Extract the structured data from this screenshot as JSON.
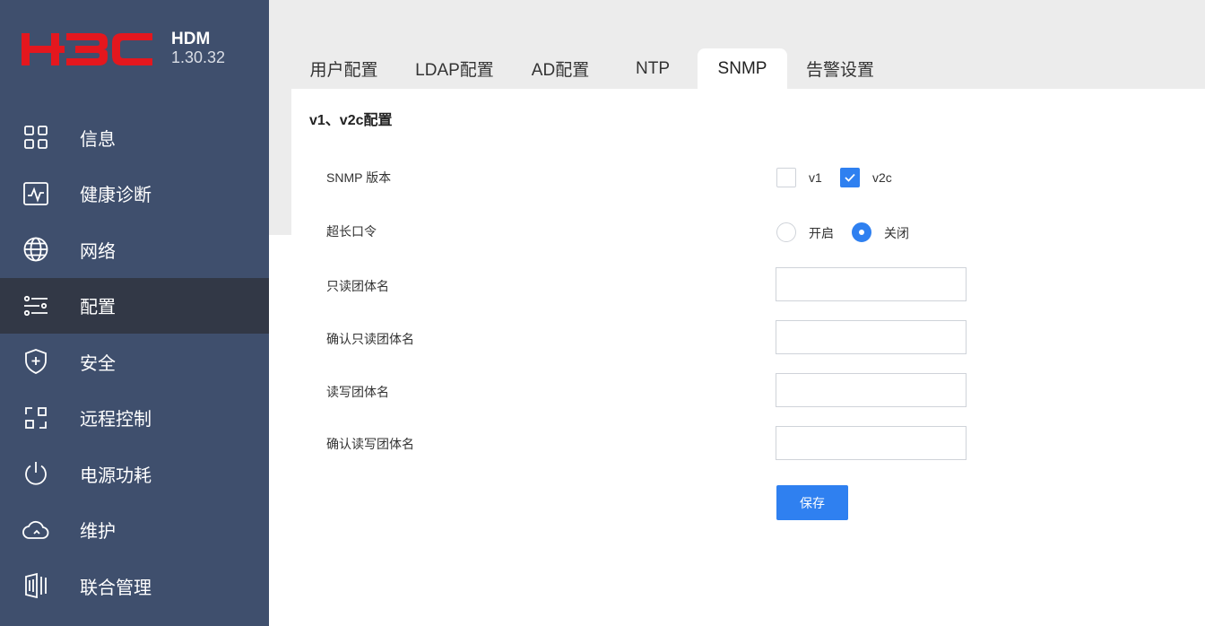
{
  "app": {
    "name": "HDM",
    "version": "1.30.32",
    "brand_color": "#e4171e",
    "logo_text": "H3C"
  },
  "sidebar": {
    "items": [
      {
        "label": "信息",
        "icon": "grid-icon"
      },
      {
        "label": "健康诊断",
        "icon": "health-monitor-icon"
      },
      {
        "label": "网络",
        "icon": "globe-icon"
      },
      {
        "label": "配置",
        "icon": "sliders-icon",
        "active": true
      },
      {
        "label": "安全",
        "icon": "shield-plus-icon"
      },
      {
        "label": "远程控制",
        "icon": "remote-control-icon"
      },
      {
        "label": "电源功耗",
        "icon": "power-icon"
      },
      {
        "label": "维护",
        "icon": "cloud-icon"
      },
      {
        "label": "联合管理",
        "icon": "server-rack-icon"
      }
    ]
  },
  "tabs": [
    {
      "label": "用户配置"
    },
    {
      "label": "LDAP配置"
    },
    {
      "label": "AD配置"
    },
    {
      "label": "NTP"
    },
    {
      "label": "SNMP",
      "active": true
    },
    {
      "label": "告警设置"
    }
  ],
  "section": {
    "title": "v1、v2c配置"
  },
  "form": {
    "snmp_version_label": "SNMP 版本",
    "v1_label": "v1",
    "v1_checked": false,
    "v2c_label": "v2c",
    "v2c_checked": true,
    "long_password_label": "超长口令",
    "on_label": "开启",
    "off_label": "关闭",
    "long_password_value": "关闭",
    "ro_community_label": "只读团体名",
    "ro_community_value": "",
    "ro_confirm_label": "确认只读团体名",
    "ro_confirm_value": "",
    "rw_community_label": "读写团体名",
    "rw_community_value": "",
    "rw_confirm_label": "确认读写团体名",
    "rw_confirm_value": "",
    "save_label": "保存"
  },
  "colors": {
    "sidebar_bg": "#3f4f6d",
    "sidebar_active_bg": "#323846",
    "accent": "#2f80f0",
    "top_band": "#ececec"
  }
}
